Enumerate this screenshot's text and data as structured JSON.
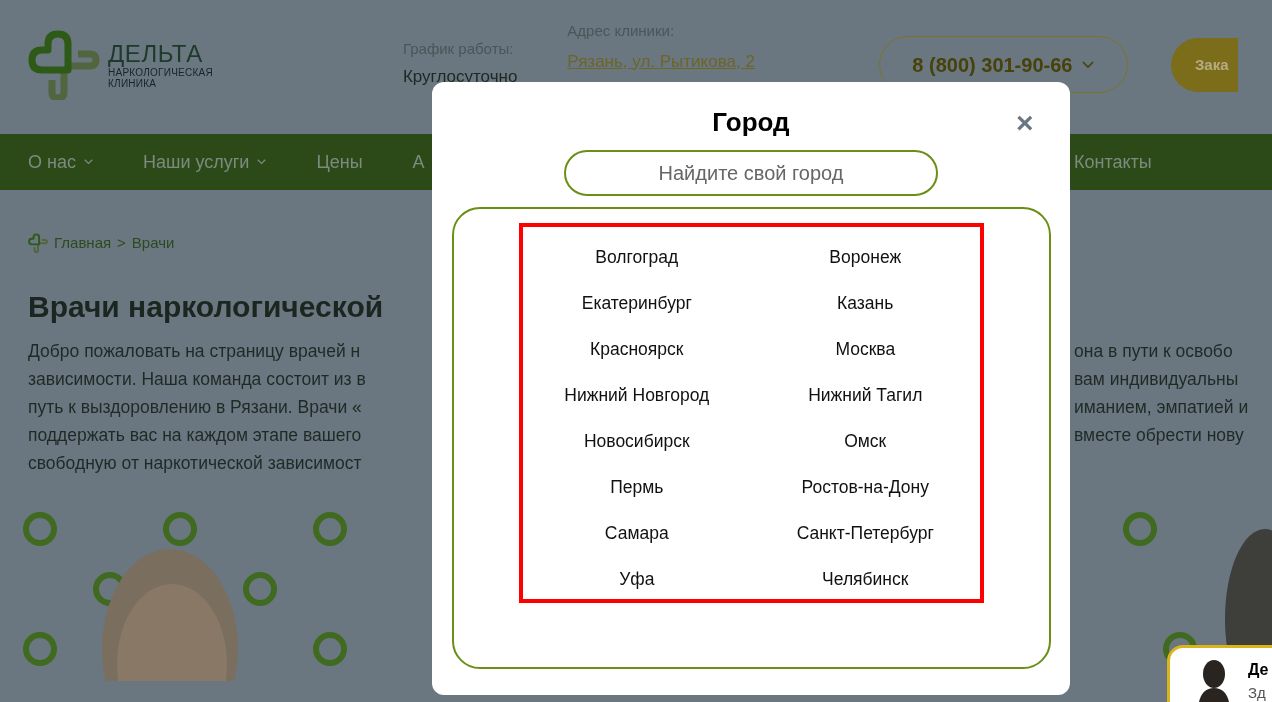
{
  "header": {
    "logo": {
      "name": "ДЕЛЬТА",
      "subtitle_lines": [
        "НАРКОЛОГИЧЕСКАЯ",
        "КЛИНИКА"
      ]
    },
    "schedule": {
      "label": "График работы:",
      "value": "Круглосуточно"
    },
    "address": {
      "label": "Адрес клиники:",
      "value": "Рязань, ул. Рытикова, 2"
    },
    "phone": "8 (800) 301-90-66",
    "order_button": "Зака"
  },
  "nav": {
    "items": [
      {
        "label": "О нас",
        "dropdown": true
      },
      {
        "label": "Наши услуги",
        "dropdown": true
      },
      {
        "label": "Цены",
        "dropdown": false
      },
      {
        "label": "А",
        "dropdown": false
      }
    ],
    "right_item": "Контакты"
  },
  "breadcrumb": {
    "items": [
      "Главная",
      "Врачи"
    ],
    "separator": ">"
  },
  "heading": "Врачи наркологической",
  "intro": {
    "left_lines": [
      "Добро пожаловать на страницу врачей н",
      "зависимости. Наша команда состоит из в",
      "путь к выздоровлению в Рязани. Врачи «",
      "поддержать вас на каждом этапе вашего",
      "свободную от наркотической зависимост"
    ],
    "right_lines": [
      "она в пути к освобо",
      "вам индивидуальны",
      "иманием, эмпатией и",
      "вместе обрести нову"
    ]
  },
  "chat_widget": {
    "name": "Де",
    "text": "Зд"
  },
  "modal": {
    "title": "Город",
    "close": "×",
    "search": {
      "placeholder": "Найдите свой город"
    },
    "cities": [
      "Волгоград",
      "Воронеж",
      "Екатеринбург",
      "Казань",
      "Красноярск",
      "Москва",
      "Нижний Новгород",
      "Нижний Тагил",
      "Новосибирск",
      "Омск",
      "Пермь",
      "Ростов-на-Дону",
      "Самара",
      "Санкт-Петербург",
      "Уфа",
      "Челябинск"
    ]
  }
}
